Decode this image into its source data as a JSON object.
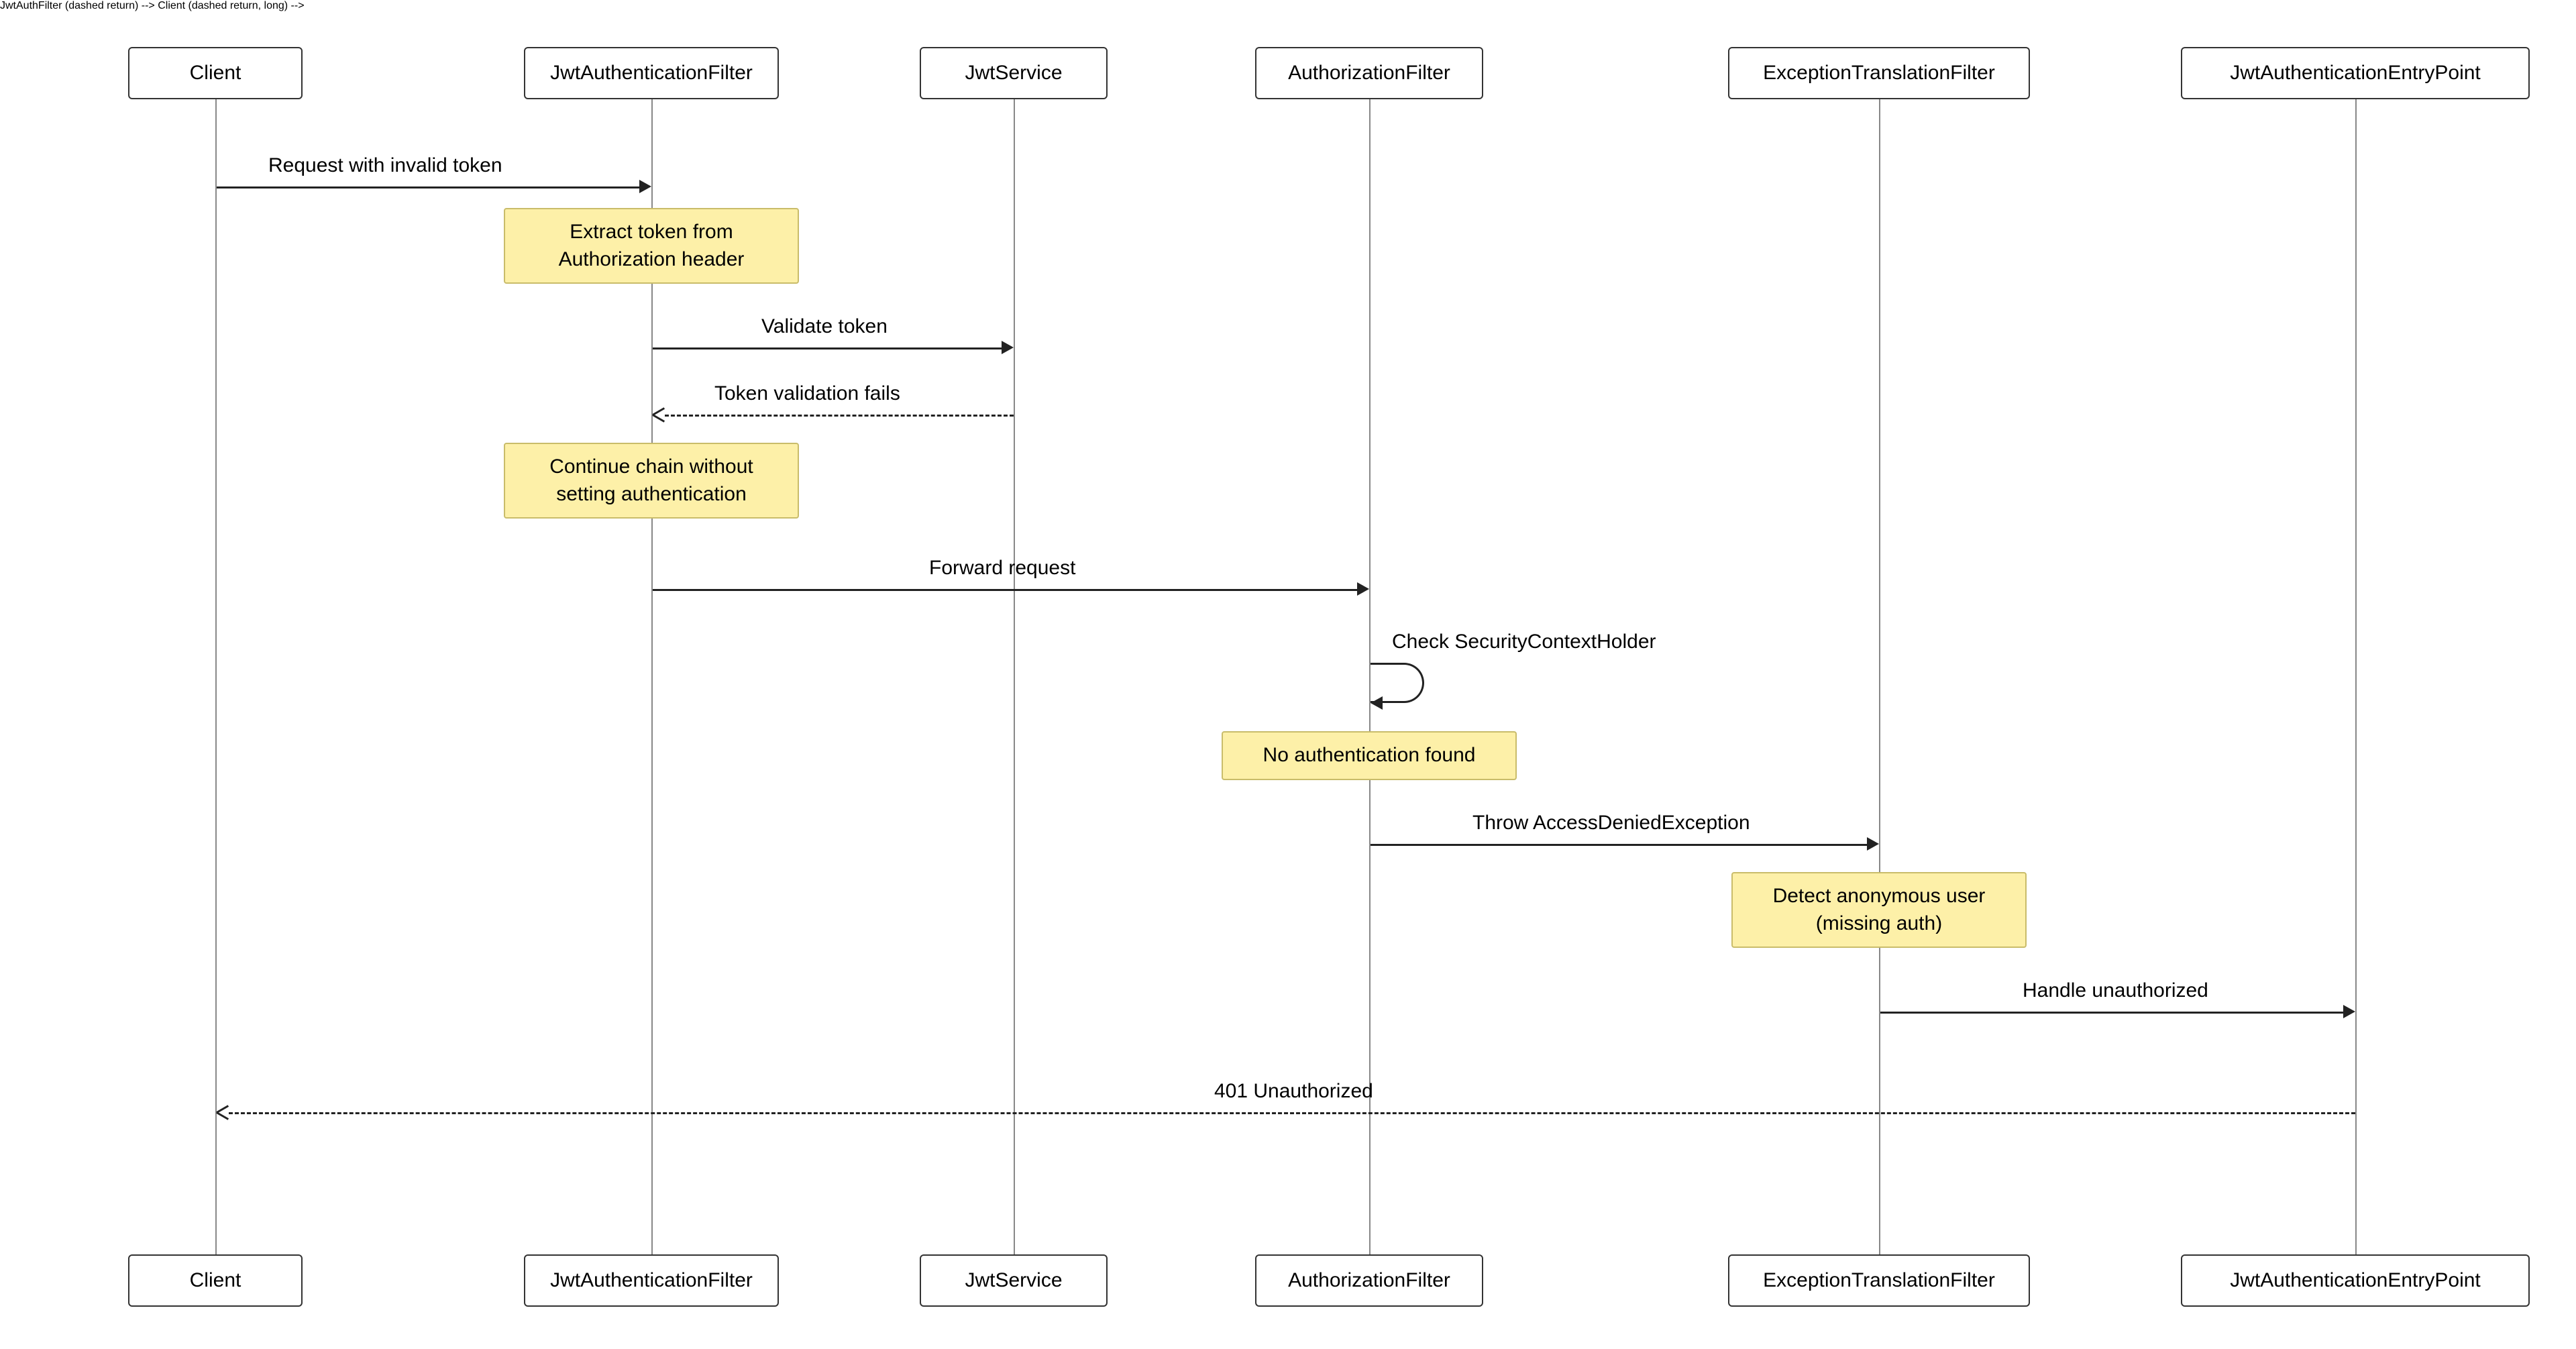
{
  "actors": {
    "client": "Client",
    "jwtAuthFilter": "JwtAuthenticationFilter",
    "jwtService": "JwtService",
    "authzFilter": "AuthorizationFilter",
    "exTransFilter": "ExceptionTranslationFilter",
    "jwtEntryPoint": "JwtAuthenticationEntryPoint"
  },
  "messages": {
    "m1": "Request with invalid token",
    "m2": "Validate token",
    "m3": "Token validation fails",
    "m4": "Forward request",
    "m5": "Check SecurityContextHolder",
    "m6": "Throw AccessDeniedException",
    "m7": "Handle unauthorized",
    "m8": "401 Unauthorized"
  },
  "notes": {
    "n1_line1": "Extract token from",
    "n1_line2": "Authorization header",
    "n2_line1": "Continue chain without",
    "n2_line2": "setting authentication",
    "n3": "No authentication found",
    "n4_line1": "Detect anonymous user",
    "n4_line2": "(missing auth)"
  },
  "chart_data": {
    "type": "sequence-diagram",
    "participants": [
      "Client",
      "JwtAuthenticationFilter",
      "JwtService",
      "AuthorizationFilter",
      "ExceptionTranslationFilter",
      "JwtAuthenticationEntryPoint"
    ],
    "interactions": [
      {
        "from": "Client",
        "to": "JwtAuthenticationFilter",
        "label": "Request with invalid token",
        "style": "solid"
      },
      {
        "over": "JwtAuthenticationFilter",
        "note": "Extract token from Authorization header"
      },
      {
        "from": "JwtAuthenticationFilter",
        "to": "JwtService",
        "label": "Validate token",
        "style": "solid"
      },
      {
        "from": "JwtService",
        "to": "JwtAuthenticationFilter",
        "label": "Token validation fails",
        "style": "dashed"
      },
      {
        "over": "JwtAuthenticationFilter",
        "note": "Continue chain without setting authentication"
      },
      {
        "from": "JwtAuthenticationFilter",
        "to": "AuthorizationFilter",
        "label": "Forward request",
        "style": "solid"
      },
      {
        "from": "AuthorizationFilter",
        "to": "AuthorizationFilter",
        "label": "Check SecurityContextHolder",
        "style": "self"
      },
      {
        "over": "AuthorizationFilter",
        "note": "No authentication found"
      },
      {
        "from": "AuthorizationFilter",
        "to": "ExceptionTranslationFilter",
        "label": "Throw AccessDeniedException",
        "style": "solid"
      },
      {
        "over": "ExceptionTranslationFilter",
        "note": "Detect anonymous user (missing auth)"
      },
      {
        "from": "ExceptionTranslationFilter",
        "to": "JwtAuthenticationEntryPoint",
        "label": "Handle unauthorized",
        "style": "solid"
      },
      {
        "from": "JwtAuthenticationEntryPoint",
        "to": "Client",
        "label": "401 Unauthorized",
        "style": "dashed"
      }
    ]
  }
}
